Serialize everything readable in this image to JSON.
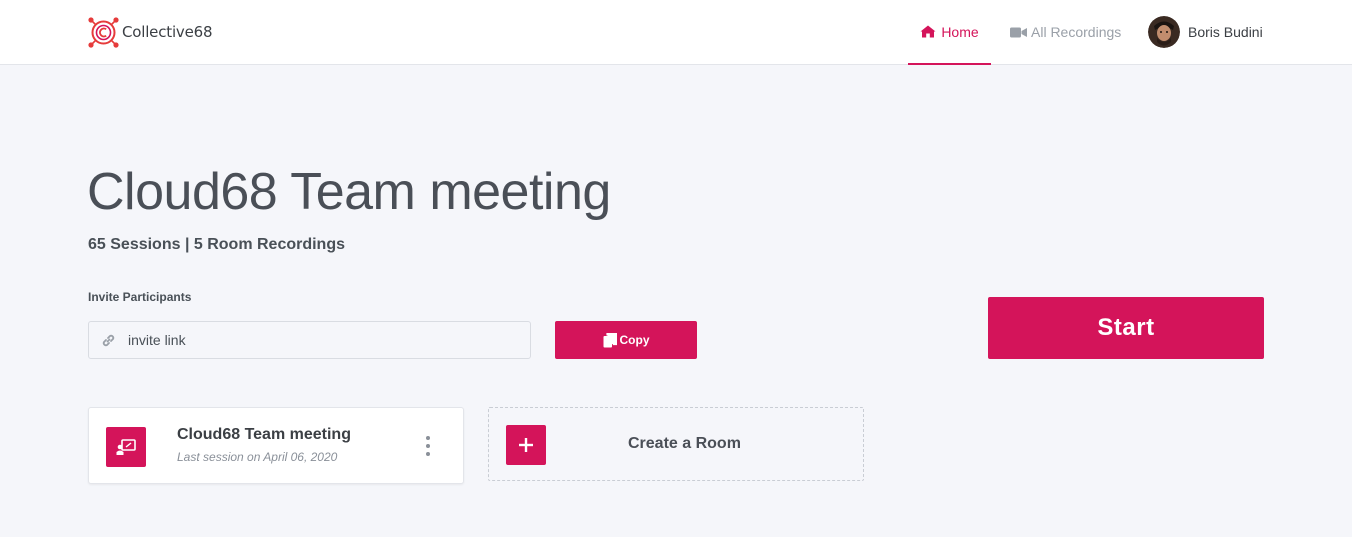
{
  "brand": {
    "name": "Collective68",
    "logo_icon": "collective68-logo-icon",
    "accent_color": "#d4145a"
  },
  "nav": {
    "home": {
      "label": "Home",
      "icon": "home-icon",
      "active": true
    },
    "recordings": {
      "label": "All Recordings",
      "icon": "video-camera-icon"
    },
    "user": {
      "name": "Boris Budini",
      "avatar": "avatar"
    }
  },
  "room": {
    "title": "Cloud68 Team meeting",
    "stats": "65 Sessions | 5 Room Recordings"
  },
  "invite": {
    "label": "Invite Participants",
    "placeholder": "invite link",
    "value": "",
    "copy_label": "Copy"
  },
  "start_label": "Start",
  "rooms": [
    {
      "name": "Cloud68 Team meeting",
      "last_session": "Last session on April 06, 2020",
      "icon": "presentation-icon"
    }
  ],
  "create_room": {
    "label": "Create a Room",
    "icon": "plus-icon"
  }
}
